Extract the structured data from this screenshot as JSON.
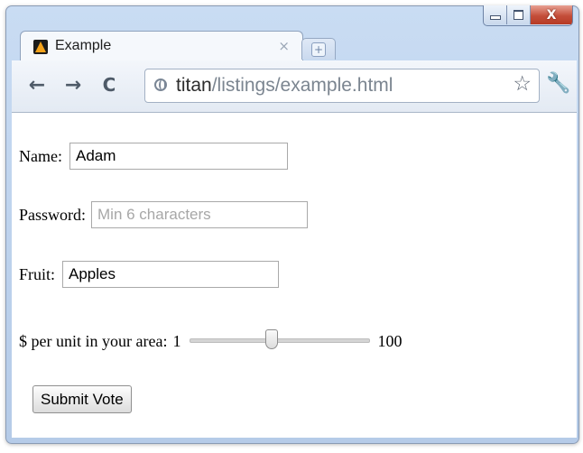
{
  "browser": {
    "tab": {
      "title": "Example",
      "close_glyph": "×",
      "favicon": "triangle-logo-icon"
    },
    "new_tab_glyph": "+",
    "toolbar": {
      "back_glyph": "←",
      "forward_glyph": "→",
      "reload_glyph": "C",
      "url_host": "titan",
      "url_path": "/listings/example.html",
      "star_glyph": "☆",
      "wrench_glyph": "🔧"
    },
    "window_controls": {
      "close_glyph": "X"
    }
  },
  "form": {
    "name": {
      "label": "Name:",
      "value": "Adam"
    },
    "password": {
      "label": "Password:",
      "placeholder": "Min 6 characters"
    },
    "fruit": {
      "label": "Fruit:",
      "value": "Apples"
    },
    "price": {
      "label": "$ per unit in your area:",
      "min_label": "1",
      "max_label": "100",
      "value_fraction": 0.45
    },
    "submit_label": "Submit Vote"
  },
  "colors": {
    "frame": "#bcd1ec",
    "close_button": "#c44e3a",
    "tab_icon": "#f3a21b"
  }
}
